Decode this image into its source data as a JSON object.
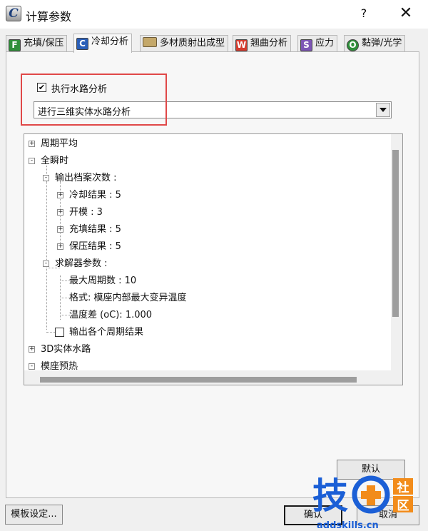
{
  "window": {
    "title": "计算参数",
    "help": "?",
    "close": "✕"
  },
  "tabs": [
    {
      "label": "充填/保压",
      "badge": "F",
      "color": "#2f8f3a"
    },
    {
      "label": "冷却分析",
      "badge": "C",
      "color": "#2a5fb8",
      "active": true
    },
    {
      "label": "多材质射出成型",
      "badge": "",
      "color": "#c4a86a"
    },
    {
      "label": "翘曲分析",
      "badge": "W",
      "color": "#d33b2e"
    },
    {
      "label": "应力",
      "badge": "S",
      "color": "#7d55b4"
    },
    {
      "label": "黏弹/光学",
      "badge": "O",
      "color": "#2f8f3a"
    }
  ],
  "cooling": {
    "enable_label": "执行水路分析",
    "enable_checked": "✔",
    "mode_value": "进行三维实体水路分析"
  },
  "tree": {
    "items": [
      "周期平均",
      "全瞬时",
      "输出档案次数 :",
      "冷却结果 : 5",
      "开模 : 3",
      "充填结果 : 5",
      "保压结果 : 5",
      "求解器参数 :",
      "最大周期数 : 10",
      "格式: 模座内部最大变异温度",
      "温度差 (oC): 1.000",
      "输出各个周期结果",
      "3D实体水路",
      "模座预热"
    ],
    "expanders": {
      "plus": "+",
      "minus": "-"
    }
  },
  "buttons": {
    "default": "默认",
    "template": "模板设定...",
    "ok": "确认",
    "cancel": "取消"
  },
  "watermark": {
    "main": "技",
    "side_top": "社",
    "side_bottom": "区",
    "url": "addskills.cn"
  },
  "colors": {
    "accent_red": "#e04848",
    "watermark_blue": "#1b5fd6",
    "watermark_orange": "#f28c1b"
  }
}
